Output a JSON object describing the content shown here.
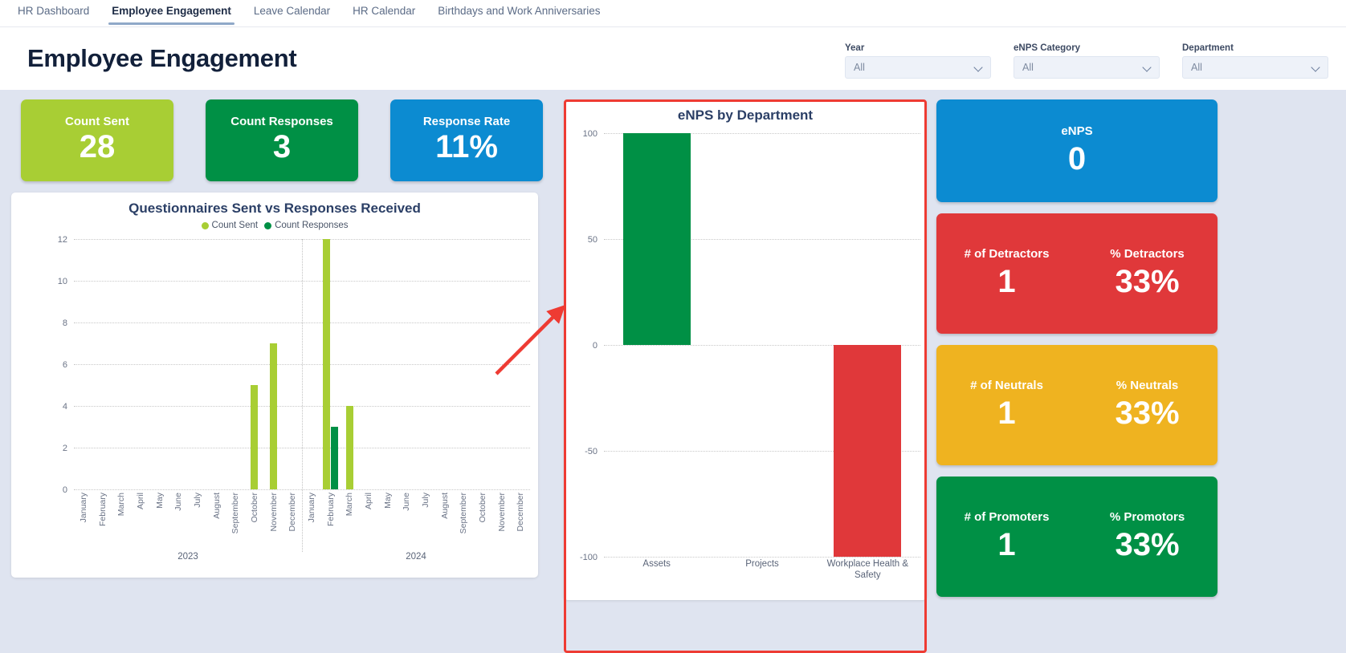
{
  "tabs": [
    {
      "label": "HR Dashboard",
      "active": false
    },
    {
      "label": "Employee Engagement",
      "active": true
    },
    {
      "label": "Leave Calendar",
      "active": false
    },
    {
      "label": "HR Calendar",
      "active": false
    },
    {
      "label": "Birthdays and Work Anniversaries",
      "active": false
    }
  ],
  "header": {
    "title": "Employee Engagement",
    "filters": [
      {
        "label": "Year",
        "value": "All"
      },
      {
        "label": "eNPS Category",
        "value": "All"
      },
      {
        "label": "Department",
        "value": "All"
      }
    ]
  },
  "kpis_top": [
    {
      "label": "Count Sent",
      "value": "28",
      "color": "#a8ce34"
    },
    {
      "label": "Count Responses",
      "value": "3",
      "color": "#009045"
    },
    {
      "label": "Response Rate",
      "value": "11%",
      "color": "#0c8bd1"
    }
  ],
  "kpis_right": [
    {
      "color": "#0c8bd1",
      "single": true,
      "label": "eNPS",
      "value": "0"
    },
    {
      "color": "#e0383a",
      "single": false,
      "label_left": "# of Detractors",
      "value_left": "1",
      "label_right": "% Detractors",
      "value_right": "33%"
    },
    {
      "color": "#efb320",
      "single": false,
      "label_left": "# of Neutrals",
      "value_left": "1",
      "label_right": "% Neutrals",
      "value_right": "33%"
    },
    {
      "color": "#009045",
      "single": false,
      "label_left": "# of Promoters",
      "value_left": "1",
      "label_right": "% Promotors",
      "value_right": "33%"
    }
  ],
  "chart_data": [
    {
      "type": "bar",
      "title": "Questionnaires Sent vs Responses Received",
      "xlabel": "",
      "ylabel": "",
      "ylim": [
        0,
        12
      ],
      "yticks": [
        0,
        2,
        4,
        6,
        8,
        10,
        12
      ],
      "grid": true,
      "legend_position": "top",
      "categories": [
        "January",
        "February",
        "March",
        "April",
        "May",
        "June",
        "July",
        "August",
        "September",
        "October",
        "November",
        "December",
        "January",
        "February",
        "March",
        "April",
        "May",
        "June",
        "July",
        "August",
        "September",
        "October",
        "November",
        "December"
      ],
      "groups": [
        {
          "label": "2023",
          "span": 12
        },
        {
          "label": "2024",
          "span": 12
        }
      ],
      "series": [
        {
          "name": "Count Sent",
          "color": "#a8ce34",
          "values": [
            0,
            0,
            0,
            0,
            0,
            0,
            0,
            0,
            0,
            5,
            7,
            0,
            0,
            12,
            4,
            0,
            0,
            0,
            0,
            0,
            0,
            0,
            0,
            0
          ]
        },
        {
          "name": "Count Responses",
          "color": "#009045",
          "values": [
            0,
            0,
            0,
            0,
            0,
            0,
            0,
            0,
            0,
            0,
            0,
            0,
            0,
            3,
            0,
            0,
            0,
            0,
            0,
            0,
            0,
            0,
            0,
            0
          ]
        }
      ]
    },
    {
      "type": "bar",
      "title": "eNPS by Department",
      "xlabel": "",
      "ylabel": "",
      "ylim": [
        -100,
        100
      ],
      "yticks": [
        100,
        50,
        0,
        -50,
        -100
      ],
      "grid": true,
      "legend_position": "none",
      "categories": [
        "Assets",
        "Projects",
        "Workplace Health & Safety"
      ],
      "values": [
        100,
        0,
        -100
      ],
      "colors": [
        "#009045",
        "#009045",
        "#e0383a"
      ]
    }
  ],
  "annotation": {
    "highlight_color": "#ee3b33",
    "arrow_color": "#ee3b33"
  }
}
